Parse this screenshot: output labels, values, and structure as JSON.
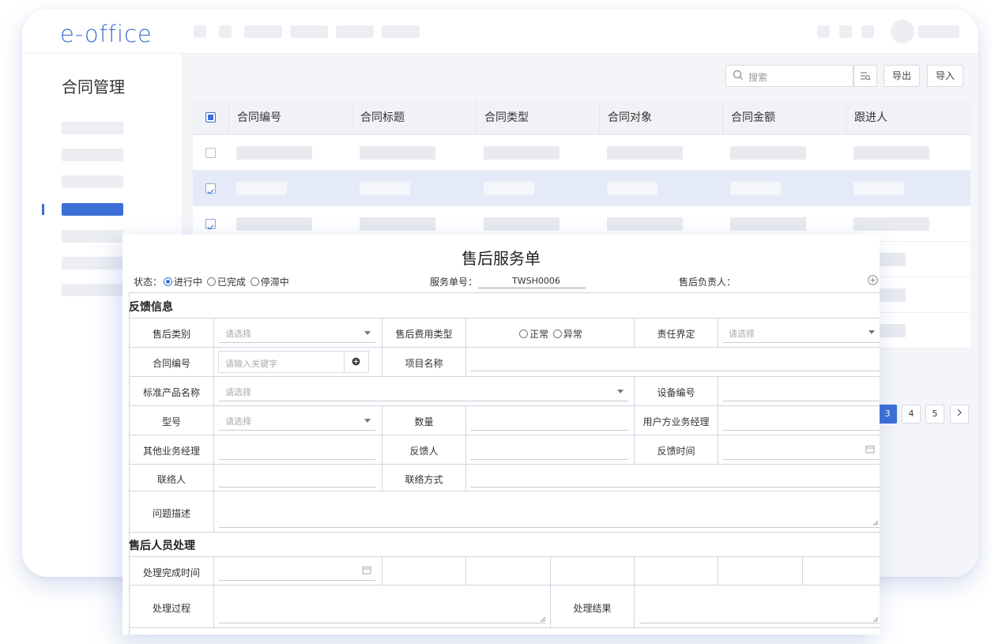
{
  "app": {
    "logo": "e-office"
  },
  "sidebar": {
    "title": "合同管理"
  },
  "toolbar": {
    "search_placeholder": "搜索",
    "filter_icon": "filter-icon",
    "export_label": "导出",
    "import_label": "导入"
  },
  "table": {
    "headers": [
      "合同编号",
      "合同标题",
      "合同类型",
      "合同对象",
      "合同金额",
      "跟进人"
    ],
    "selected_rows": [
      1,
      2
    ]
  },
  "pagination": {
    "pages": [
      "3",
      "4",
      "5"
    ],
    "current": "3"
  },
  "form": {
    "title": "售后服务单",
    "status_label": "状态：",
    "status_options": [
      "进行中",
      "已完成",
      "停滞中"
    ],
    "status_selected": "进行中",
    "order_no_label": "服务单号：",
    "order_no_value": "TWSH0006",
    "owner_label": "售后负责人：",
    "section1": "反馈信息",
    "section2": "售后人员处理",
    "labels": {
      "after_sales_type": "售后类别",
      "fee_type": "售后费用类型",
      "responsibility": "责任界定",
      "contract_no": "合同编号",
      "project_name": "项目名称",
      "product_name": "标准产品名称",
      "device_no": "设备编号",
      "model": "型号",
      "quantity": "数量",
      "client_manager": "用户方业务经理",
      "other_manager": "其他业务经理",
      "feedback_person": "反馈人",
      "feedback_time": "反馈时间",
      "contact": "联络人",
      "contact_method": "联络方式",
      "problem_desc": "问题描述",
      "finish_time": "处理完成时间",
      "process": "处理过程",
      "result": "处理结果"
    },
    "placeholders": {
      "select": "请选择",
      "keyword": "请输入关键字"
    },
    "fee_options": [
      "正常",
      "异常"
    ]
  }
}
